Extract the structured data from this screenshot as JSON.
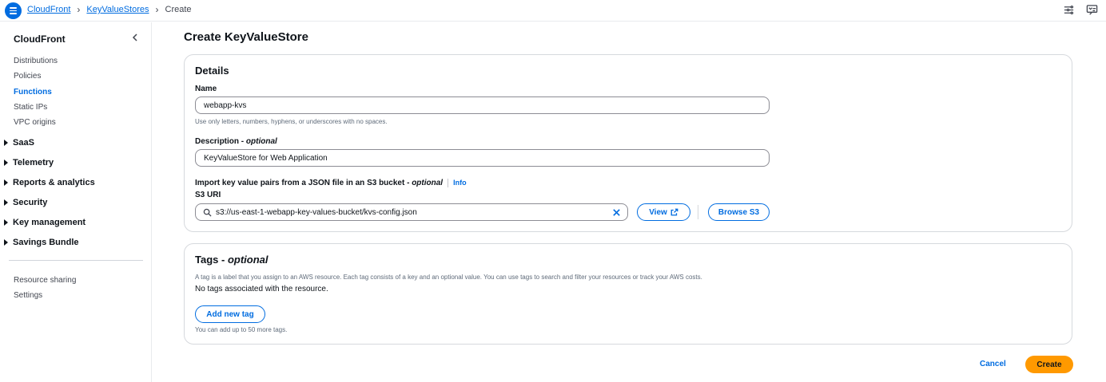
{
  "breadcrumbs": {
    "items": [
      "CloudFront",
      "KeyValueStores"
    ],
    "current": "Create"
  },
  "sidebar": {
    "title": "CloudFront",
    "links": [
      "Distributions",
      "Policies",
      "Functions",
      "Static IPs",
      "VPC origins"
    ],
    "active": "Functions",
    "groups": [
      "SaaS",
      "Telemetry",
      "Reports & analytics",
      "Security",
      "Key management",
      "Savings Bundle"
    ],
    "bottom_links": [
      "Resource sharing",
      "Settings"
    ]
  },
  "page": {
    "title": "Create KeyValueStore"
  },
  "details": {
    "heading": "Details",
    "name_label": "Name",
    "name_value": "webapp-kvs",
    "name_hint": "Use only letters, numbers, hyphens, or underscores with no spaces.",
    "description_label": "Description",
    "description_optional": "optional",
    "description_value": "KeyValueStore for Web Application",
    "import_label": "Import key value pairs from a JSON file in an S3 bucket",
    "import_optional": "optional",
    "info_label": "Info",
    "s3_label": "S3 URI",
    "s3_value": "s3://us-east-1-webapp-key-values-bucket/kvs-config.json",
    "view_label": "View",
    "browse_label": "Browse S3"
  },
  "tags": {
    "heading": "Tags",
    "heading_optional": "optional",
    "description": "A tag is a label that you assign to an AWS resource. Each tag consists of a key and an optional value. You can use tags to search and filter your resources or track your AWS costs.",
    "empty_text": "No tags associated with the resource.",
    "add_label": "Add new tag",
    "limit_hint": "You can add up to 50 more tags."
  },
  "footer": {
    "cancel_label": "Cancel",
    "create_label": "Create"
  },
  "colors": {
    "link": "#006ce0",
    "primary_button": "#ff9900",
    "border": "#d6d9dd"
  }
}
